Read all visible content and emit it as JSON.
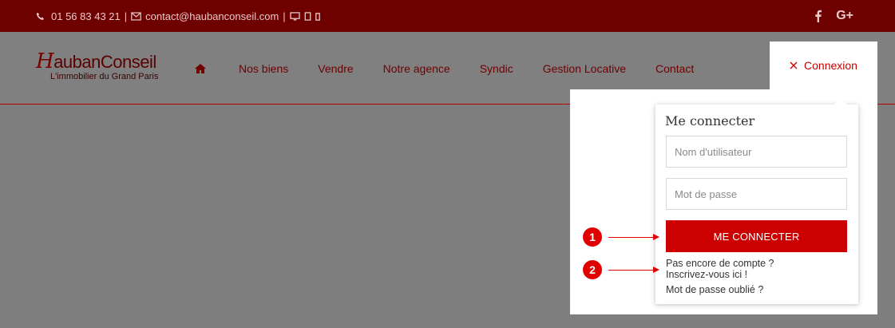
{
  "topbar": {
    "phone": "01 56 83 43 21",
    "sep1": "|",
    "email": "contact@haubanconseil.com",
    "sep2": "|",
    "social": [
      "facebook-icon",
      "google-plus-icon"
    ],
    "colors": {
      "background": "#6e0000"
    }
  },
  "logo": {
    "letter": "H",
    "name1": "auban",
    "name2": "Conseil",
    "tagline": "L'immobilier du Grand Paris"
  },
  "nav": {
    "home_icon": "home-icon",
    "items": [
      "Nos biens",
      "Vendre",
      "Notre agence",
      "Syndic",
      "Gestion Locative",
      "Contact"
    ]
  },
  "connexion": {
    "label": "Connexion",
    "icon": "close-icon"
  },
  "login": {
    "title": "Me connecter",
    "username_placeholder": "Nom d'utilisateur",
    "password_placeholder": "Mot de passe",
    "submit": "ME CONNECTER",
    "signup_line1": "Pas encore de compte ?",
    "signup_line2": "Inscrivez-vous ici !",
    "forgot": "Mot de passe oublié ?"
  },
  "annotations": {
    "callout1": "1",
    "callout2": "2"
  },
  "colors": {
    "accent": "#cc0000",
    "callout": "#e00000"
  }
}
